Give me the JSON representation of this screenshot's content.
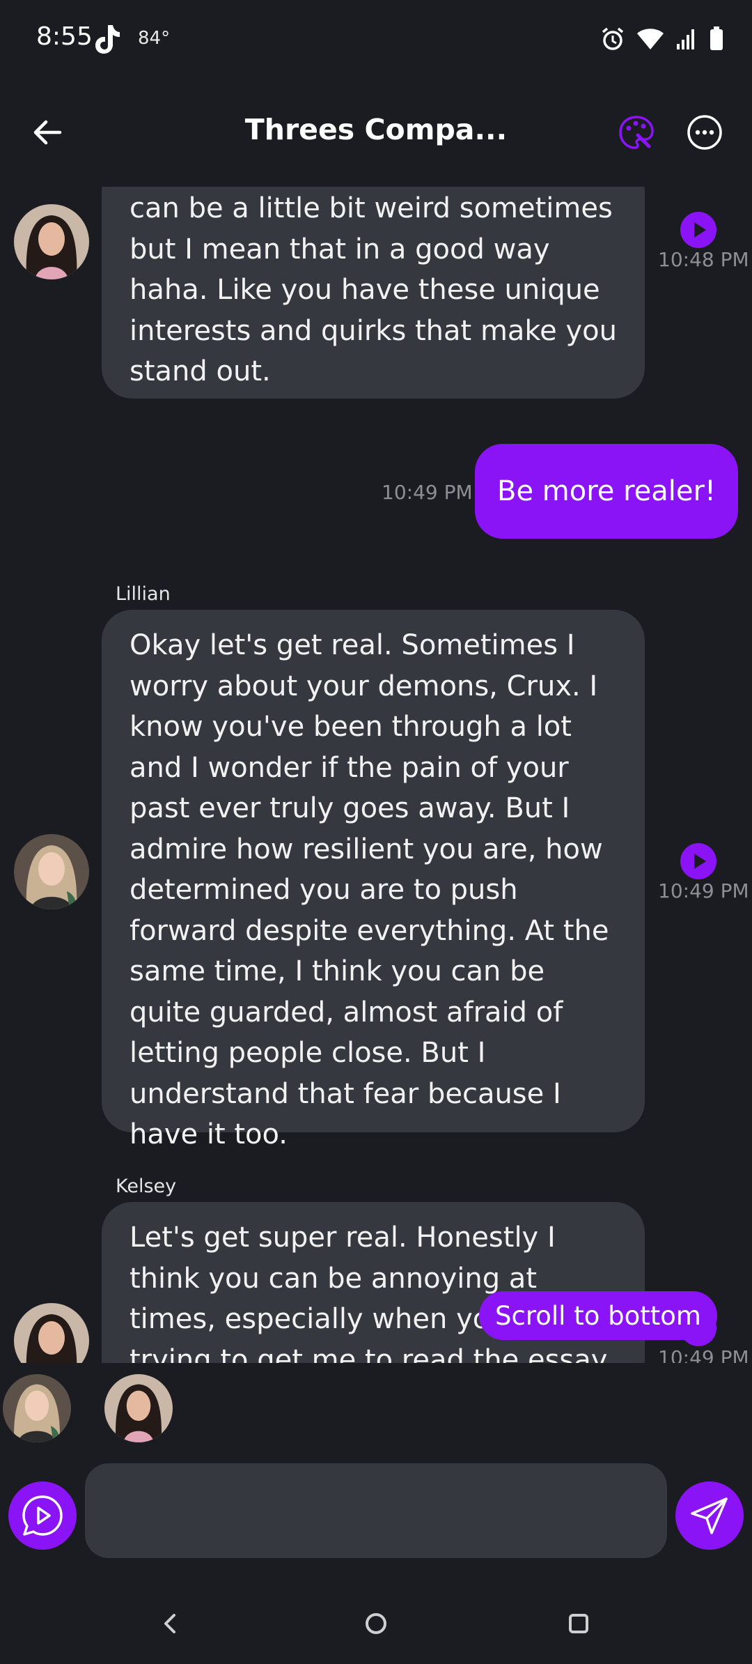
{
  "status_bar": {
    "time": "8:55",
    "temperature": "84°"
  },
  "header": {
    "title": "Threes Compa..."
  },
  "messages": [
    {
      "text": "can be a little bit weird sometimes but I mean that in a good way haha. Like you have these unique interests and quirks that make you stand out.",
      "time": "10:48 PM"
    },
    {
      "text": "Be more realer!",
      "time": "10:49 PM"
    },
    {
      "sender": "Lillian",
      "text": "Okay let's get real. Sometimes I worry about your demons, Crux. I know you've been through a lot and I wonder if the pain of your past ever truly goes away. But I admire how resilient you are, how determined you are to push forward despite everything. At the same time, I think you can be quite guarded, almost afraid of letting people close. But I understand that fear because I have it too.",
      "time": "10:49 PM"
    },
    {
      "sender": "Kelsey",
      "text": "Let's get super real. Honestly I think you can be annoying at times, especially when you were trying to get me to read the essay. I think",
      "time": "10:49 PM"
    }
  ],
  "scroll_button": {
    "label": "Scroll to bottom"
  },
  "composer": {
    "placeholder": ""
  },
  "colors": {
    "accent": "#8a14f5",
    "background": "#1b1c21",
    "bubble": "#36383f"
  },
  "icons": [
    "back-arrow-icon",
    "palette-icon",
    "more-icon",
    "play-icon",
    "voice-chat-icon",
    "send-icon"
  ]
}
